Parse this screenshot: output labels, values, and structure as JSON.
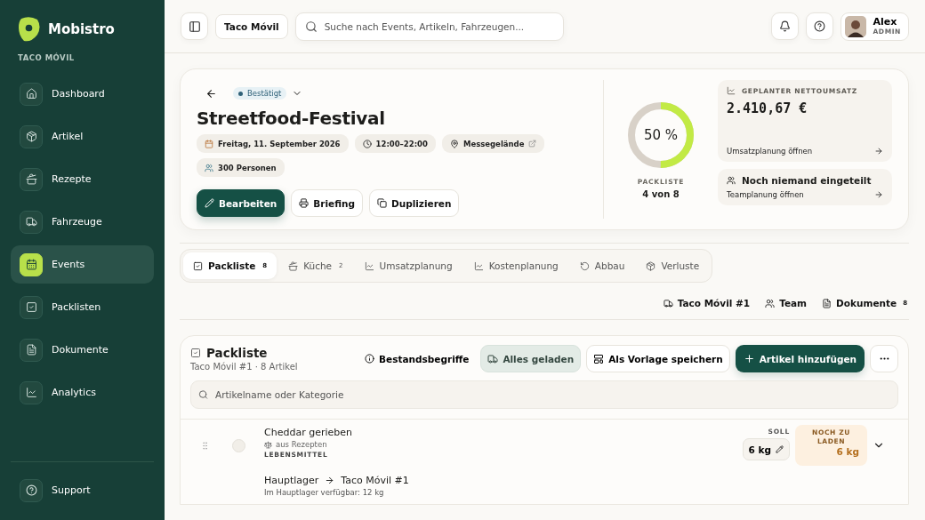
{
  "brand": {
    "name": "Mobistro",
    "company": "TACO MÓVIL"
  },
  "nav": [
    {
      "label": "Dashboard",
      "selected": false
    },
    {
      "label": "Artikel",
      "selected": false
    },
    {
      "label": "Rezepte",
      "selected": false
    },
    {
      "label": "Fahrzeuge",
      "selected": false
    },
    {
      "label": "Events",
      "selected": true
    },
    {
      "label": "Packlisten",
      "selected": false
    },
    {
      "label": "Dokumente",
      "selected": false
    },
    {
      "label": "Analytics",
      "selected": false
    }
  ],
  "support": {
    "label": "Support"
  },
  "header": {
    "org": "Taco Móvil",
    "search_placeholder": "Suche nach Events, Artikeln, Fahrzeugen...",
    "user": {
      "name": "Alex",
      "role": "ADMIN"
    }
  },
  "event": {
    "status": "Bestätigt",
    "title": "Streetfood-Festival",
    "meta": [
      {
        "kind": "date",
        "text": "Freitag, 11. September 2026"
      },
      {
        "kind": "time",
        "text": "12:00–22:00"
      },
      {
        "kind": "place",
        "text": "Messegelände"
      },
      {
        "kind": "people",
        "text": "300 Personen"
      }
    ],
    "actions": [
      {
        "label": "Bearbeiten",
        "kind": "edit"
      },
      {
        "label": "Briefing",
        "kind": "print"
      },
      {
        "label": "Duplizieren",
        "kind": "copy"
      }
    ],
    "progress": {
      "level": 0.5,
      "percent": "50 %",
      "label": "PACKLISTE",
      "count": "4 von 8"
    },
    "revenue": {
      "label": "GEPLANTER NETTOUMSATZ",
      "amount": "2.410,67 €",
      "link": "Umsatzplanung öffnen"
    },
    "team": {
      "title": "Noch niemand eingeteilt",
      "link": "Teamplanung öffnen"
    }
  },
  "tabs": [
    {
      "label": "Packliste",
      "count": "8",
      "selected": true
    },
    {
      "label": "Küche",
      "count": "2",
      "selected": false
    },
    {
      "label": "Umsatzplanung",
      "selected": false
    },
    {
      "label": "Kostenplanung",
      "selected": false
    },
    {
      "label": "Abbau",
      "selected": false
    },
    {
      "label": "Verluste",
      "selected": false
    }
  ],
  "links": [
    {
      "label": "Taco Móvil #1"
    },
    {
      "label": "Team"
    },
    {
      "label": "Dokumente",
      "count": "8"
    }
  ],
  "packlist": {
    "title": "Packliste",
    "subtitle": "Taco Móvil #1 · 8 Artikel",
    "info": "Bestandsbegriffe",
    "loaded_button": "Alles geladen",
    "template_button": "Als Vorlage speichern",
    "add_button": "Artikel hinzufügen",
    "filter_placeholder": "Artikelname oder Kategorie",
    "items": [
      {
        "name": "Cheddar gerieben",
        "source": "aus Rezepten",
        "category": "LEBENSMITTEL",
        "checked": false,
        "soll_label": "SOLL",
        "soll": "6 kg",
        "remaining_label": "NOCH ZU LADEN",
        "remaining": "6 kg",
        "from": "Hauptlager",
        "to": "Taco Móvil #1",
        "availability": "Im Hauptlager verfügbar: 12 kg"
      }
    ]
  }
}
